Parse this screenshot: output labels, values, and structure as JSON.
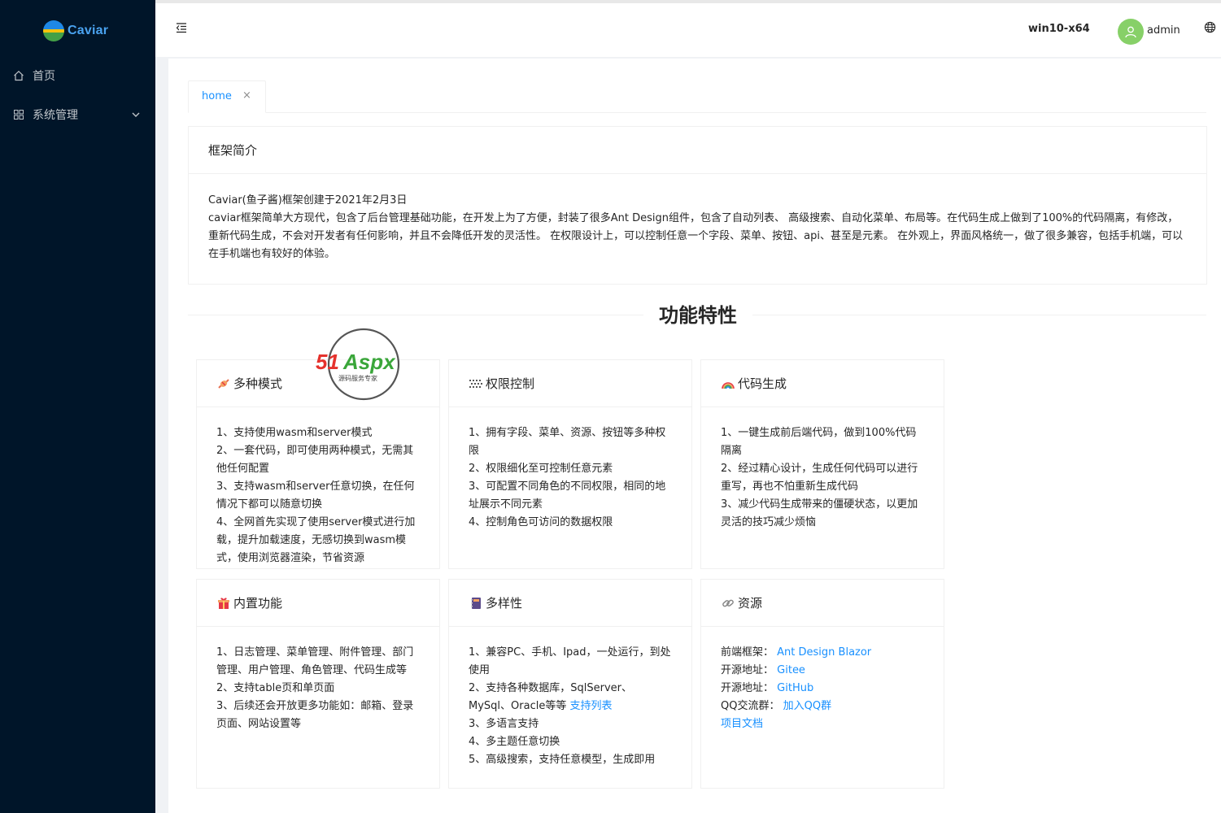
{
  "app": {
    "logo_text": "Caviar"
  },
  "sidebar": {
    "items": [
      {
        "label": "首页",
        "icon": "home-icon"
      },
      {
        "label": "系统管理",
        "icon": "appstore-icon",
        "expandable": true
      }
    ]
  },
  "header": {
    "host": "win10-x64",
    "user": "admin"
  },
  "tabs": [
    {
      "label": "home",
      "close": "×"
    }
  ],
  "intro": {
    "title": "框架简介",
    "line1": "Caviar(鱼子酱)框架创建于2021年2月3日",
    "line2": "caviar框架简单大方现代，包含了后台管理基础功能，在开发上为了方便，封装了很多Ant Design组件，包含了自动列表、 高级搜索、自动化菜单、布局等。在代码生成上做到了100%的代码隔离，有修改，重新代码生成，不会对开发者有任何影响，并且不会降低开发的灵活性。 在权限设计上，可以控制任意一个字段、菜单、按钮、api、甚至是元素。 在外观上，界面风格统一，做了很多兼容，包括手机端，可以在手机端也有较好的体验。"
  },
  "features_title": "功能特性",
  "watermark": {
    "brand": "51Aspx",
    "tagline": "源码服务专家"
  },
  "cards": [
    {
      "title": "多种模式",
      "icon": "candy-icon",
      "lines": [
        "1、支持使用wasm和server模式",
        "2、一套代码，即可使用两种模式，无需其他任何配置",
        "3、支持wasm和server任意切换，在任何情况下都可以随意切换",
        "4、全网首先实现了使用server模式进行加载，提升加载速度，无感切换到wasm模式，使用浏览器渲染，节省资源"
      ]
    },
    {
      "title": "权限控制",
      "icon": "grid-icon",
      "lines": [
        "1、拥有字段、菜单、资源、按钮等多种权限",
        "2、权限细化至可控制任意元素",
        "3、可配置不同角色的不同权限，相同的地址展示不同元素",
        "4、控制角色可访问的数据权限"
      ]
    },
    {
      "title": "代码生成",
      "icon": "rainbow-icon",
      "lines": [
        "1、一键生成前后端代码，做到100%代码隔离",
        "2、经过精心设计，生成任何代码可以进行重写，再也不怕重新生成代码",
        "3、减少代码生成带来的僵硬状态，以更加灵活的技巧减少烦恼"
      ]
    },
    {
      "title": "内置功能",
      "icon": "gift-icon",
      "lines": [
        "1、日志管理、菜单管理、附件管理、部门管理、用户管理、角色管理、代码生成等",
        "2、支持table页和单页面",
        "3、后续还会开放更多功能如：邮箱、登录页面、网站设置等"
      ]
    },
    {
      "title": "多样性",
      "icon": "notebook-icon",
      "lines": [
        "1、兼容PC、手机、Ipad，一处运行，到处使用",
        "2、支持各种数据库，SqlServer、MySql、Oracle等等",
        "3、多语言支持",
        "4、多主题任意切换",
        "5、高级搜索，支持任意模型，生成即用"
      ],
      "link_after_line_2": "支持列表"
    },
    {
      "title": "资源",
      "icon": "link-icon",
      "resources": [
        {
          "label": "前端框架：",
          "link": "Ant Design Blazor"
        },
        {
          "label": "开源地址：",
          "link": "Gitee"
        },
        {
          "label": "开源地址：",
          "link": "GitHub"
        },
        {
          "label": "QQ交流群：",
          "link": "加入QQ群"
        },
        {
          "label": "",
          "link": "项目文档"
        }
      ]
    }
  ],
  "colors": {
    "sidebar_bg": "#001529",
    "primary": "#1890ff",
    "avatar_bg": "#87d068",
    "watermark_red": "#e5322d",
    "watermark_green": "#3aa63a"
  }
}
